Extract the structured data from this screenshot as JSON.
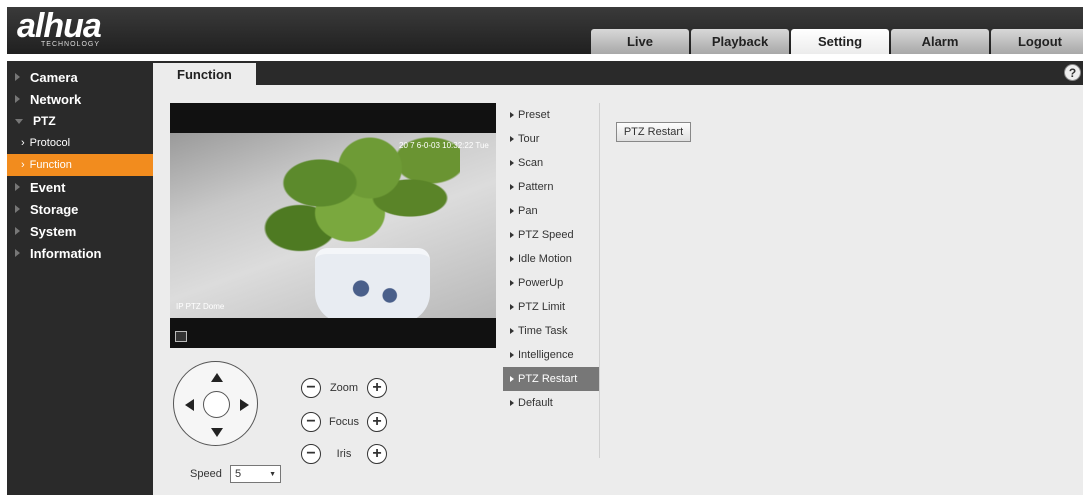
{
  "logo": {
    "main": "alhua",
    "sub": "TECHNOLOGY"
  },
  "nav": [
    {
      "label": "Live"
    },
    {
      "label": "Playback"
    },
    {
      "label": "Setting"
    },
    {
      "label": "Alarm"
    },
    {
      "label": "Logout"
    }
  ],
  "sidebar": {
    "camera": "Camera",
    "network": "Network",
    "ptz": "PTZ",
    "protocol": "Protocol",
    "function": "Function",
    "event": "Event",
    "storage": "Storage",
    "system": "System",
    "information": "Information"
  },
  "tab": {
    "title": "Function",
    "help": "?"
  },
  "video": {
    "timestamp": "20 7 6-0-03 10:32:22 Tue",
    "label": "IP PTZ Dome"
  },
  "controls": {
    "zoom": "Zoom",
    "focus": "Focus",
    "iris": "Iris",
    "minus": "−",
    "plus": "+",
    "speed_label": "Speed",
    "speed_value": "5",
    "dropdown_arrow": "▼"
  },
  "func_menu": [
    "Preset",
    "Tour",
    "Scan",
    "Pattern",
    "Pan",
    "PTZ Speed",
    "Idle Motion",
    "PowerUp",
    "PTZ Limit",
    "Time Task",
    "Intelligence",
    "PTZ Restart",
    "Default"
  ],
  "restart_button": "PTZ Restart",
  "colors": {
    "accent": "#f28c1e",
    "header": "#2a2a2a",
    "content_bg": "#ececec"
  }
}
